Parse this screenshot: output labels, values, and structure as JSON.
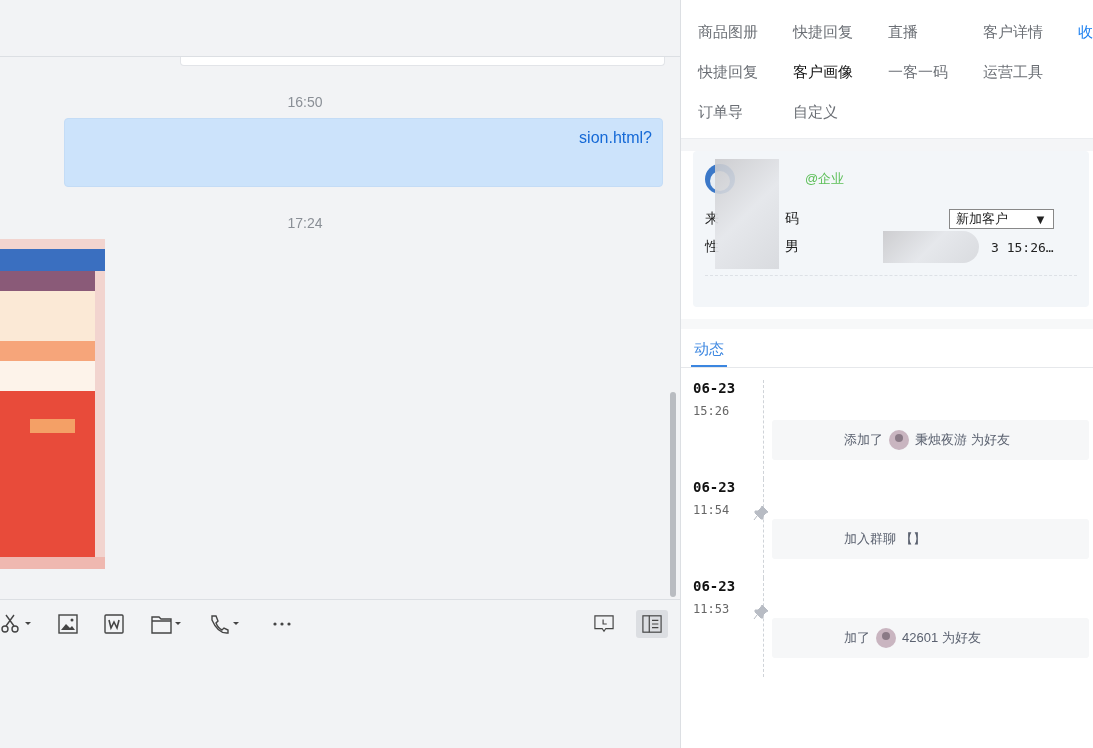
{
  "chat": {
    "messages": [
      {
        "kind": "time",
        "text": "16:50"
      },
      {
        "kind": "link",
        "text": "sion.html?"
      },
      {
        "kind": "time",
        "text": "17:24"
      },
      {
        "kind": "picture"
      }
    ]
  },
  "toolbar": {
    "selected_panel": true
  },
  "tools": {
    "rows": [
      [
        {
          "label": "商品图册",
          "selected": false,
          "kind": "tab"
        },
        {
          "label": "快捷回复",
          "selected": false,
          "kind": "tab"
        },
        {
          "label": "直播",
          "selected": false,
          "kind": "tab"
        },
        {
          "label": "客户详情",
          "selected": false,
          "kind": "tab"
        },
        {
          "label": "收",
          "kind": "link"
        }
      ],
      [
        {
          "label": "快捷回复",
          "selected": false,
          "kind": "tab"
        },
        {
          "label": "客户画像",
          "selected": true,
          "kind": "tab"
        },
        {
          "label": "一客一码",
          "selected": false,
          "kind": "tab"
        },
        {
          "label": "运营工具",
          "selected": false,
          "kind": "tab"
        }
      ],
      [
        {
          "label": "订单导",
          "selected": false,
          "kind": "tab"
        },
        {
          "label": "自定义",
          "selected": false,
          "kind": "tab"
        }
      ]
    ]
  },
  "profile": {
    "tag": "@企业",
    "source_label": "来",
    "source_value": "码",
    "gender_label": "性",
    "gender_value": "男",
    "stage_value": "新加客户",
    "stage_caret": "▼",
    "time": "3 15:26…"
  },
  "activity": {
    "tabs": [
      {
        "label": "动态",
        "selected": true
      }
    ],
    "entries": [
      {
        "date": "06-23",
        "time": "15:26",
        "pinned": false,
        "action": "添加了",
        "avatar": true,
        "rest": "秉烛夜游 为好友"
      },
      {
        "date": "06-23",
        "time": "11:54",
        "pinned": true,
        "action": "加入群聊 【】",
        "avatar": false
      },
      {
        "date": "06-23",
        "time": "11:53",
        "pinned": true,
        "action": "加了",
        "avatar": true,
        "rest": "42601 为好友"
      }
    ]
  }
}
